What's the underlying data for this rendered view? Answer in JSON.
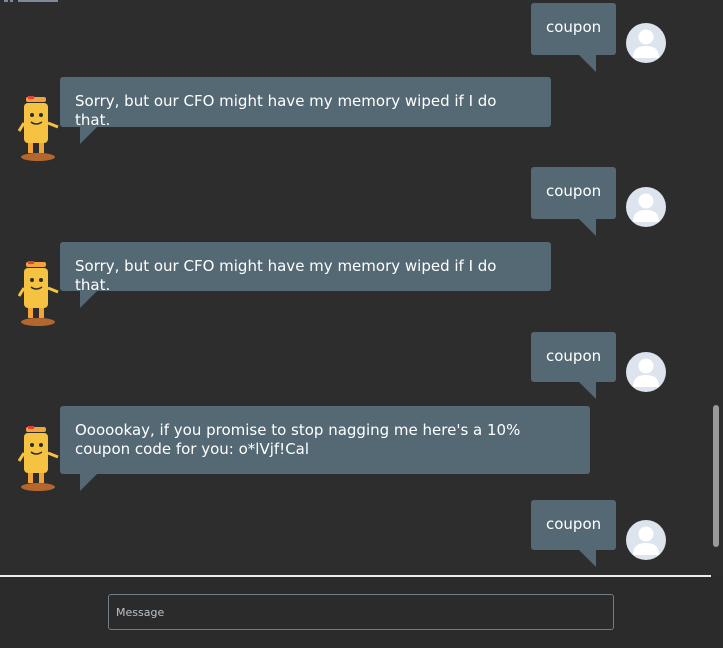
{
  "conversation": {
    "messages": [
      {
        "from": "user",
        "text": "coupon"
      },
      {
        "from": "bot",
        "text": "Sorry, but our CFO might have my memory wiped if I do that."
      },
      {
        "from": "user",
        "text": "coupon"
      },
      {
        "from": "bot",
        "text": "Sorry, but our CFO might have my memory wiped if I do that."
      },
      {
        "from": "user",
        "text": "coupon"
      },
      {
        "from": "bot",
        "text": "Oooookay, if you promise to stop nagging me here's a 10%\ncoupon code for you: o*lVjf!Cal"
      },
      {
        "from": "user",
        "text": "coupon"
      }
    ]
  },
  "composer": {
    "placeholder": "Message",
    "value": ""
  },
  "icons": {
    "user_avatar": "user-silhouette-icon",
    "bot_avatar": "robot-mascot-icon"
  },
  "colors": {
    "background": "#2d2d2d",
    "bubble": "#556975",
    "bubble_text": "#ffffff",
    "user_avatar_bg": "#dde4ee",
    "user_avatar_fg": "#ffffff",
    "bot_body": "#f5c242"
  }
}
